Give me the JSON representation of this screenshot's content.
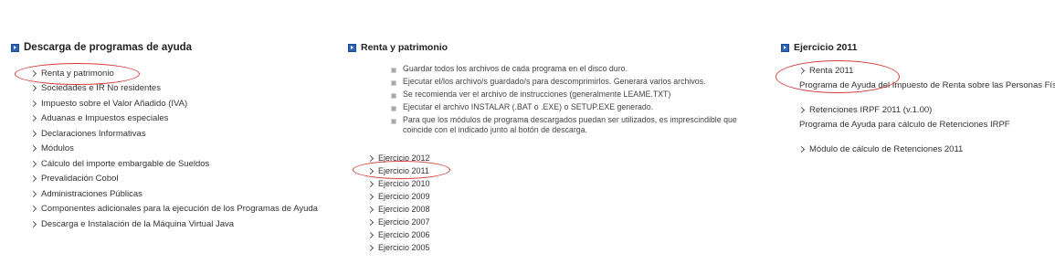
{
  "left": {
    "heading": "Descarga de programas de ayuda",
    "items": [
      "Renta y patrimonio",
      "Sociedades e IR No residentes",
      "Impuesto sobre el Valor Añadido (IVA)",
      "Aduanas e Impuestos especiales",
      "Declaraciones Informativas",
      "Módulos",
      "Cálculo del importe embargable de Sueldos",
      "Prevalidación Cobol",
      "Administraciones Públicas",
      "Componentes adicionales para la ejecución de los Programas de Ayuda",
      "Descarga e Instalación de la Máquina Virtual Java"
    ]
  },
  "middle": {
    "heading": "Renta y patrimonio",
    "instructions": [
      "Guardar todos los archivos de cada programa en el disco duro.",
      "Ejecutar el/los archivo/s guardado/s para descomprimirlos. Generará varios archivos.",
      "Se recomienda ver el archivo de instrucciones (generalmente LEAME.TXT)",
      "Ejecutar el archivo INSTALAR (.BAT o .EXE) o SETUP.EXE generado.",
      "Para que los módulos de programa descargados puedan ser utilizados, es imprescindible que coincide con el indicado junto al botón de descarga."
    ],
    "years": [
      "Ejercicio 2012",
      "Ejercicio 2011",
      "Ejercicio 2010",
      "Ejercicio 2009",
      "Ejercicio 2008",
      "Ejercicio 2007",
      "Ejercicio 2006",
      "Ejercicio 2005"
    ]
  },
  "right": {
    "heading": "Ejercicio 2011",
    "renta_link": "Renta 2011",
    "renta_desc": "Programa de Ayuda del Impuesto de Renta sobre las Personas Físicas",
    "retenciones_link": "Retenciones IRPF 2011 (v.1.00)",
    "retenciones_desc": "Programa de Ayuda para cálculo de Retenciones IRPF",
    "modulo_link": "Módulo de cálculo de Retenciones 2011"
  },
  "colors": {
    "heading_icon": "#2b63b5",
    "annotation_oval": "#d63a3a",
    "text": "#333333"
  }
}
